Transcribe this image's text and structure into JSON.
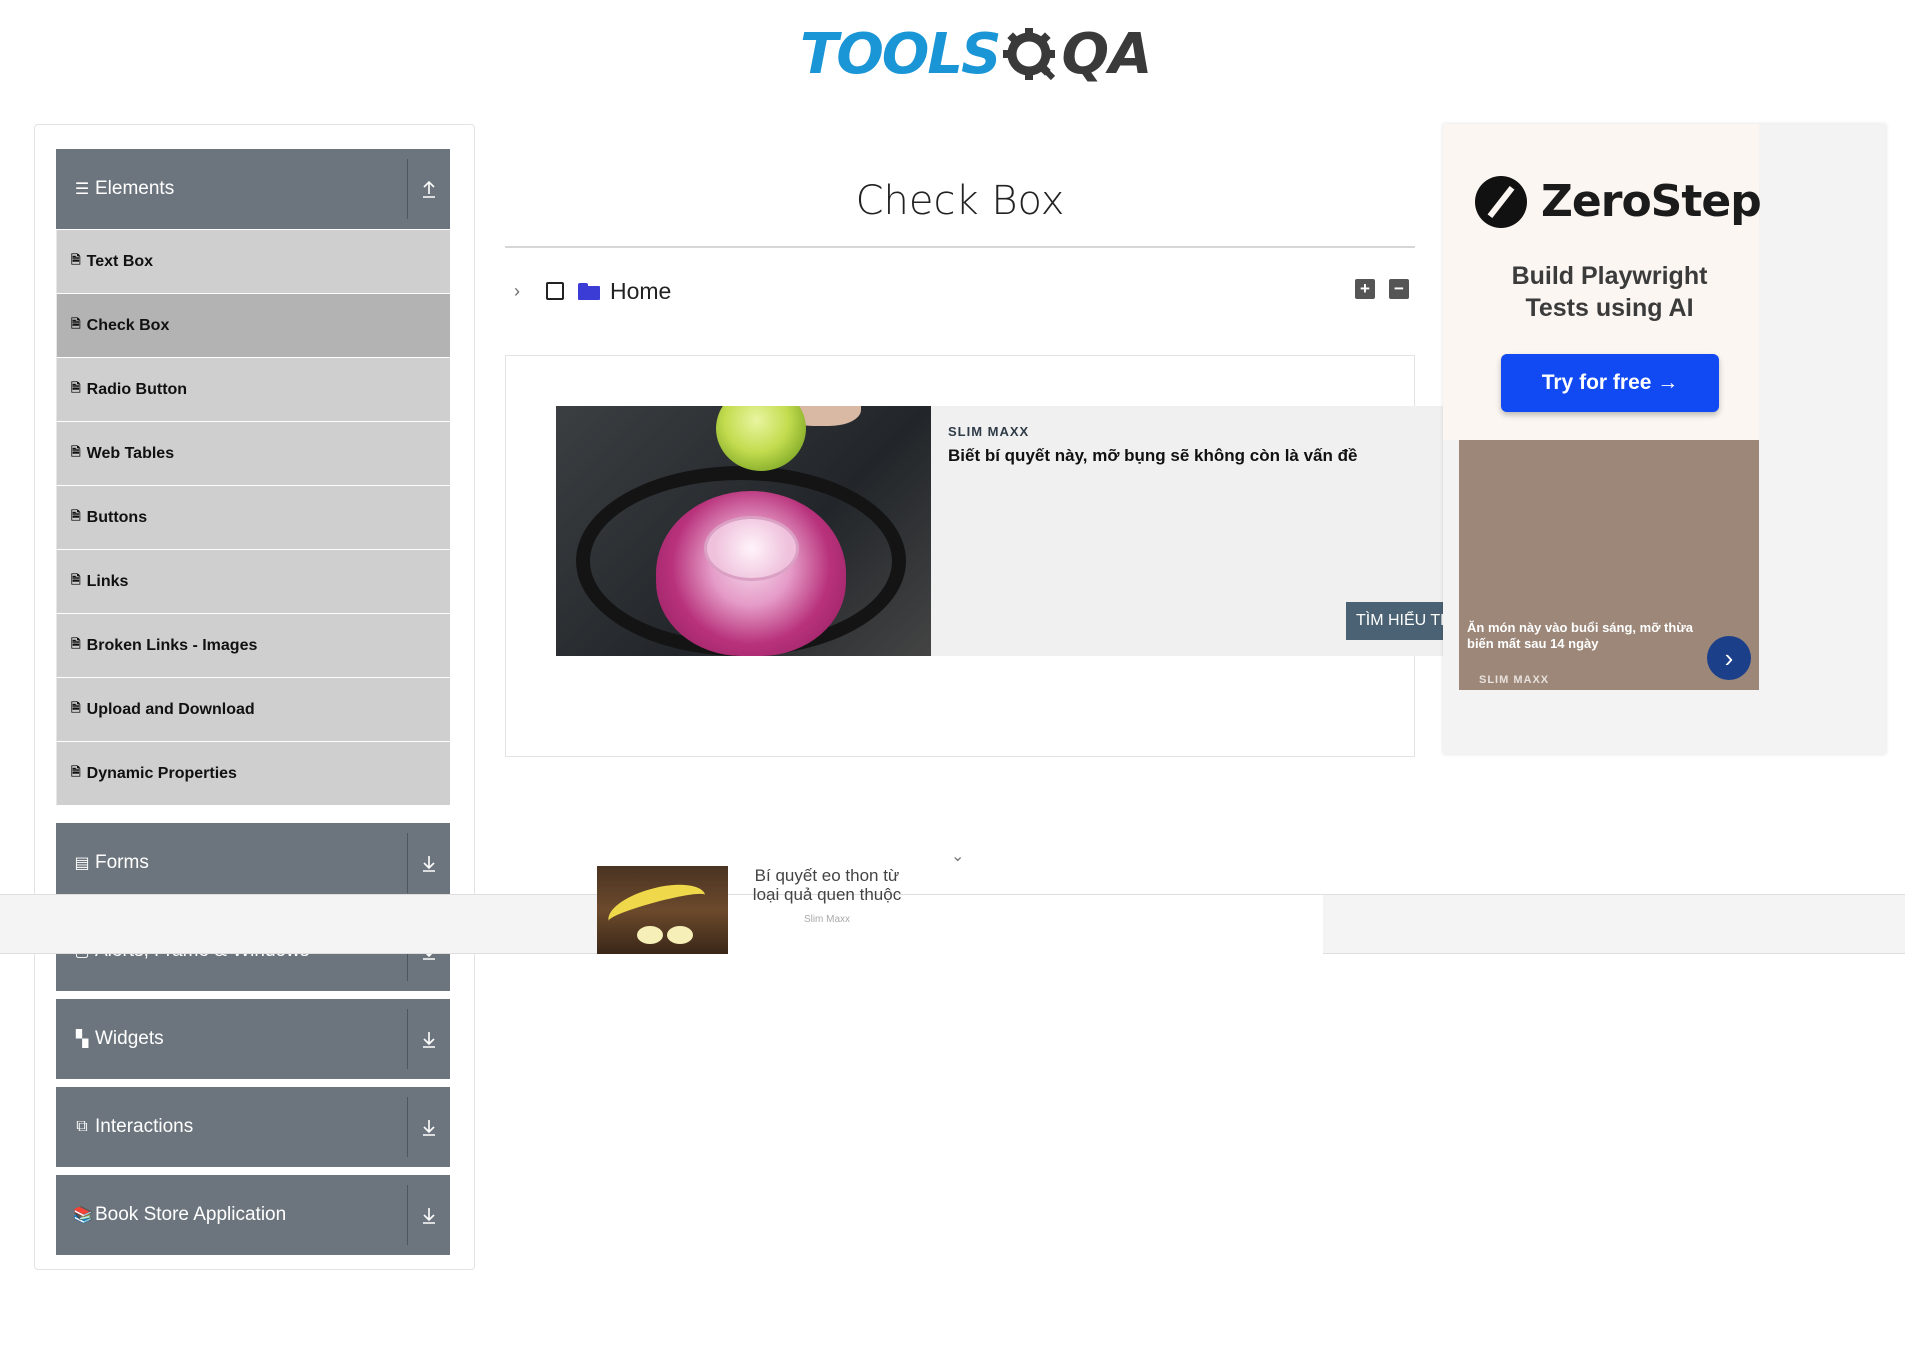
{
  "logo": {
    "tools": "TOOLS",
    "qa": "QA"
  },
  "sidebar": {
    "elements_group": {
      "title": "Elements",
      "icon": "hamburger-icon",
      "arrow": "collapse-up-icon"
    },
    "items": [
      {
        "label": "Text Box"
      },
      {
        "label": "Check Box",
        "active": true
      },
      {
        "label": "Radio Button"
      },
      {
        "label": "Web Tables"
      },
      {
        "label": "Buttons"
      },
      {
        "label": "Links"
      },
      {
        "label": "Broken Links - Images"
      },
      {
        "label": "Upload and Download"
      },
      {
        "label": "Dynamic Properties"
      }
    ],
    "groups": [
      {
        "title": "Forms",
        "icon": "form-icon"
      },
      {
        "title": "Alerts, Frame & Windows",
        "icon": "window-icon"
      },
      {
        "title": "Widgets",
        "icon": "widget-icon"
      },
      {
        "title": "Interactions",
        "icon": "interaction-icon"
      },
      {
        "title": "Book Store Application",
        "icon": "book-icon"
      }
    ]
  },
  "main": {
    "title": "Check Box",
    "tree": {
      "root_label": "Home",
      "expand_all": "+",
      "collapse_all": "−"
    }
  },
  "inline_ad": {
    "brand": "SLIM MAXX",
    "headline": "Biết bí quyết này, mỡ bụng sẽ không còn là vấn đề",
    "cta": "TÌM HIỂU THÊM"
  },
  "right_ad": {
    "name": "ZeroStep",
    "tagline_1": "Build Playwright",
    "tagline_2": "Tests using AI",
    "button": "Try for free →",
    "slim_text": "Ăn món này vào buổi sáng, mỡ thừa biến mất sau 14 ngày",
    "slim_brand": "SLIM MAXX"
  },
  "bottom_ad": {
    "text": "Bí quyết eo thon từ loại quả quen thuộc",
    "brand": "Slim Maxx"
  },
  "colors": {
    "sidebar_header": "#6c757d",
    "sidebar_item": "#cfcfcf",
    "accent_blue": "#1149f2",
    "logo_blue": "#1a95d6"
  }
}
